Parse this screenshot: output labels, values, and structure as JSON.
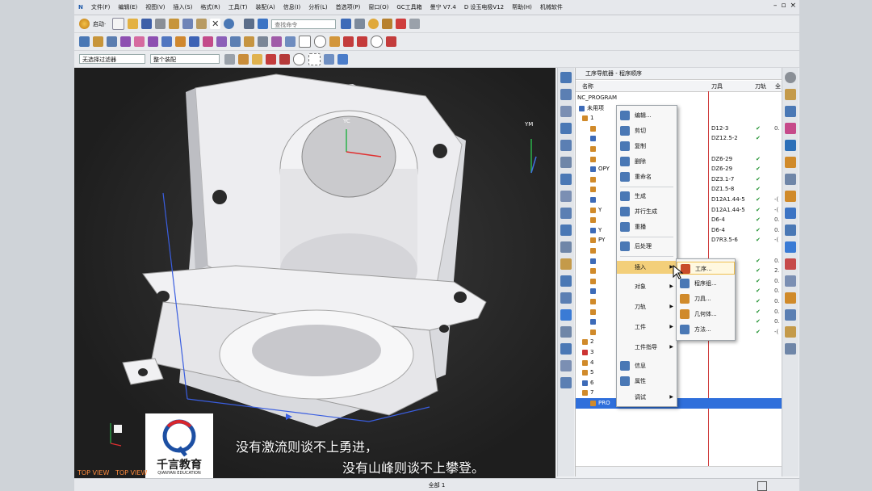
{
  "menu": [
    "文件(F)",
    "编辑(E)",
    "视图(V)",
    "插入(S)",
    "格式(R)",
    "工具(T)",
    "装配(A)",
    "信息(I)",
    "分析(L)",
    "首选项(P)",
    "窗口(O)",
    "GC工具箱",
    "曼宁 V7.4",
    "D 设玉电极V12",
    "帮助(H)",
    "机械软件"
  ],
  "toolbar": {
    "start_label": "启动·",
    "command_search_placeholder": "查找命令",
    "filter_select": "无选择过滤器",
    "assembly_select": "整个装配"
  },
  "navigator": {
    "title": "工序导航器 - 程序顺序",
    "columns": {
      "name": "名称",
      "tool": "刀具",
      "path": "刀轨",
      "extra": "全"
    },
    "rows": [
      {
        "name": "NC_PROGRAM",
        "tool": "",
        "check": "",
        "extra": ""
      },
      {
        "name": "未用项",
        "tool": "",
        "check": "",
        "extra": ""
      },
      {
        "name": "1",
        "tool": "",
        "check": "",
        "extra": ""
      },
      {
        "name": "",
        "tool": "D12-3",
        "check": "✔",
        "extra": "0."
      },
      {
        "name": "",
        "tool": "DZ12.5-2",
        "check": "✔",
        "extra": ""
      },
      {
        "name": "",
        "tool": "",
        "check": "",
        "extra": ""
      },
      {
        "name": "",
        "tool": "DZ6-29",
        "check": "✔",
        "extra": ""
      },
      {
        "name": "OPY",
        "tool": "DZ6-29",
        "check": "✔",
        "extra": ""
      },
      {
        "name": "",
        "tool": "DZ3.1-7",
        "check": "✔",
        "extra": ""
      },
      {
        "name": "",
        "tool": "DZ1.5-8",
        "check": "✔",
        "extra": ""
      },
      {
        "name": "",
        "tool": "D12A1.44-5",
        "check": "✔",
        "extra": "-("
      },
      {
        "name": "Y",
        "tool": "D12A1.44-5",
        "check": "✔",
        "extra": "-("
      },
      {
        "name": "",
        "tool": "D6-4",
        "check": "✔",
        "extra": "0."
      },
      {
        "name": "Y",
        "tool": "D6-4",
        "check": "✔",
        "extra": "0."
      },
      {
        "name": "PY",
        "tool": "D7R3.5-6",
        "check": "✔",
        "extra": "-("
      },
      {
        "name": "",
        "tool": "",
        "check": "",
        "extra": ""
      },
      {
        "name": "",
        "tool": "",
        "check": "✔",
        "extra": "0."
      },
      {
        "name": "",
        "tool": "",
        "check": "✔",
        "extra": "2."
      },
      {
        "name": "",
        "tool": "",
        "check": "✔",
        "extra": "0."
      },
      {
        "name": "",
        "tool": "",
        "check": "✔",
        "extra": "0."
      },
      {
        "name": "",
        "tool": "",
        "check": "✔",
        "extra": "0."
      },
      {
        "name": "",
        "tool": "",
        "check": "✔",
        "extra": "0."
      },
      {
        "name": "",
        "tool": "9",
        "check": "✔",
        "extra": "0."
      },
      {
        "name": "",
        "tool": "",
        "check": "✔",
        "extra": "-("
      },
      {
        "name": "2",
        "tool": "",
        "check": "",
        "extra": ""
      },
      {
        "name": "3",
        "tool": "",
        "check": "",
        "extra": ""
      },
      {
        "name": "4",
        "tool": "",
        "check": "",
        "extra": ""
      },
      {
        "name": "5",
        "tool": "",
        "check": "",
        "extra": ""
      },
      {
        "name": "6",
        "tool": "",
        "check": "",
        "extra": ""
      },
      {
        "name": "7",
        "tool": "",
        "check": "",
        "extra": ""
      },
      {
        "name": "PRO",
        "tool": "",
        "check": "",
        "extra": ""
      }
    ]
  },
  "context_menu": {
    "items": [
      "编辑...",
      "剪切",
      "复制",
      "删除",
      "重命名",
      "生成",
      "并行生成",
      "重播",
      "后处理",
      "插入",
      "对象",
      "刀轨",
      "工件",
      "工件指导",
      "信息",
      "属性",
      "调试"
    ],
    "colors": [
      "#d08a2a",
      "#4a78b5",
      "#4a78b5",
      "#5a5a5a",
      "#d08a2a",
      "#4a78b5",
      "#4a78b5",
      "#4a78b5",
      "#4a78b5",
      "#d08a2a",
      "#ffffff",
      "#ffffff",
      "#ffffff",
      "#ffffff",
      "#4a78b5",
      "#4a78b5",
      "#ffffff"
    ]
  },
  "submenu": {
    "items": [
      "工序...",
      "程序组...",
      "刀具...",
      "几何体...",
      "方法..."
    ],
    "colors": [
      "#c84b2a",
      "#4a78b5",
      "#d08a2a",
      "#d08a2a",
      "#4a78b5"
    ]
  },
  "viewport": {
    "labels": [
      "TOP VIEW",
      "TOP VIEW"
    ],
    "axes": [
      "YC",
      "YM"
    ]
  },
  "logo": {
    "text": "千言教育",
    "subtext": "QIANYAN EDUCATION"
  },
  "captions": [
    "没有激流则谈不上勇进，",
    "没有山峰则谈不上攀登。"
  ],
  "status": {
    "text": "全部 1"
  },
  "colors": {
    "menu_highlight": "#f3cf7a",
    "selection": "#2f6fdb",
    "check": "#1a8f2a"
  }
}
